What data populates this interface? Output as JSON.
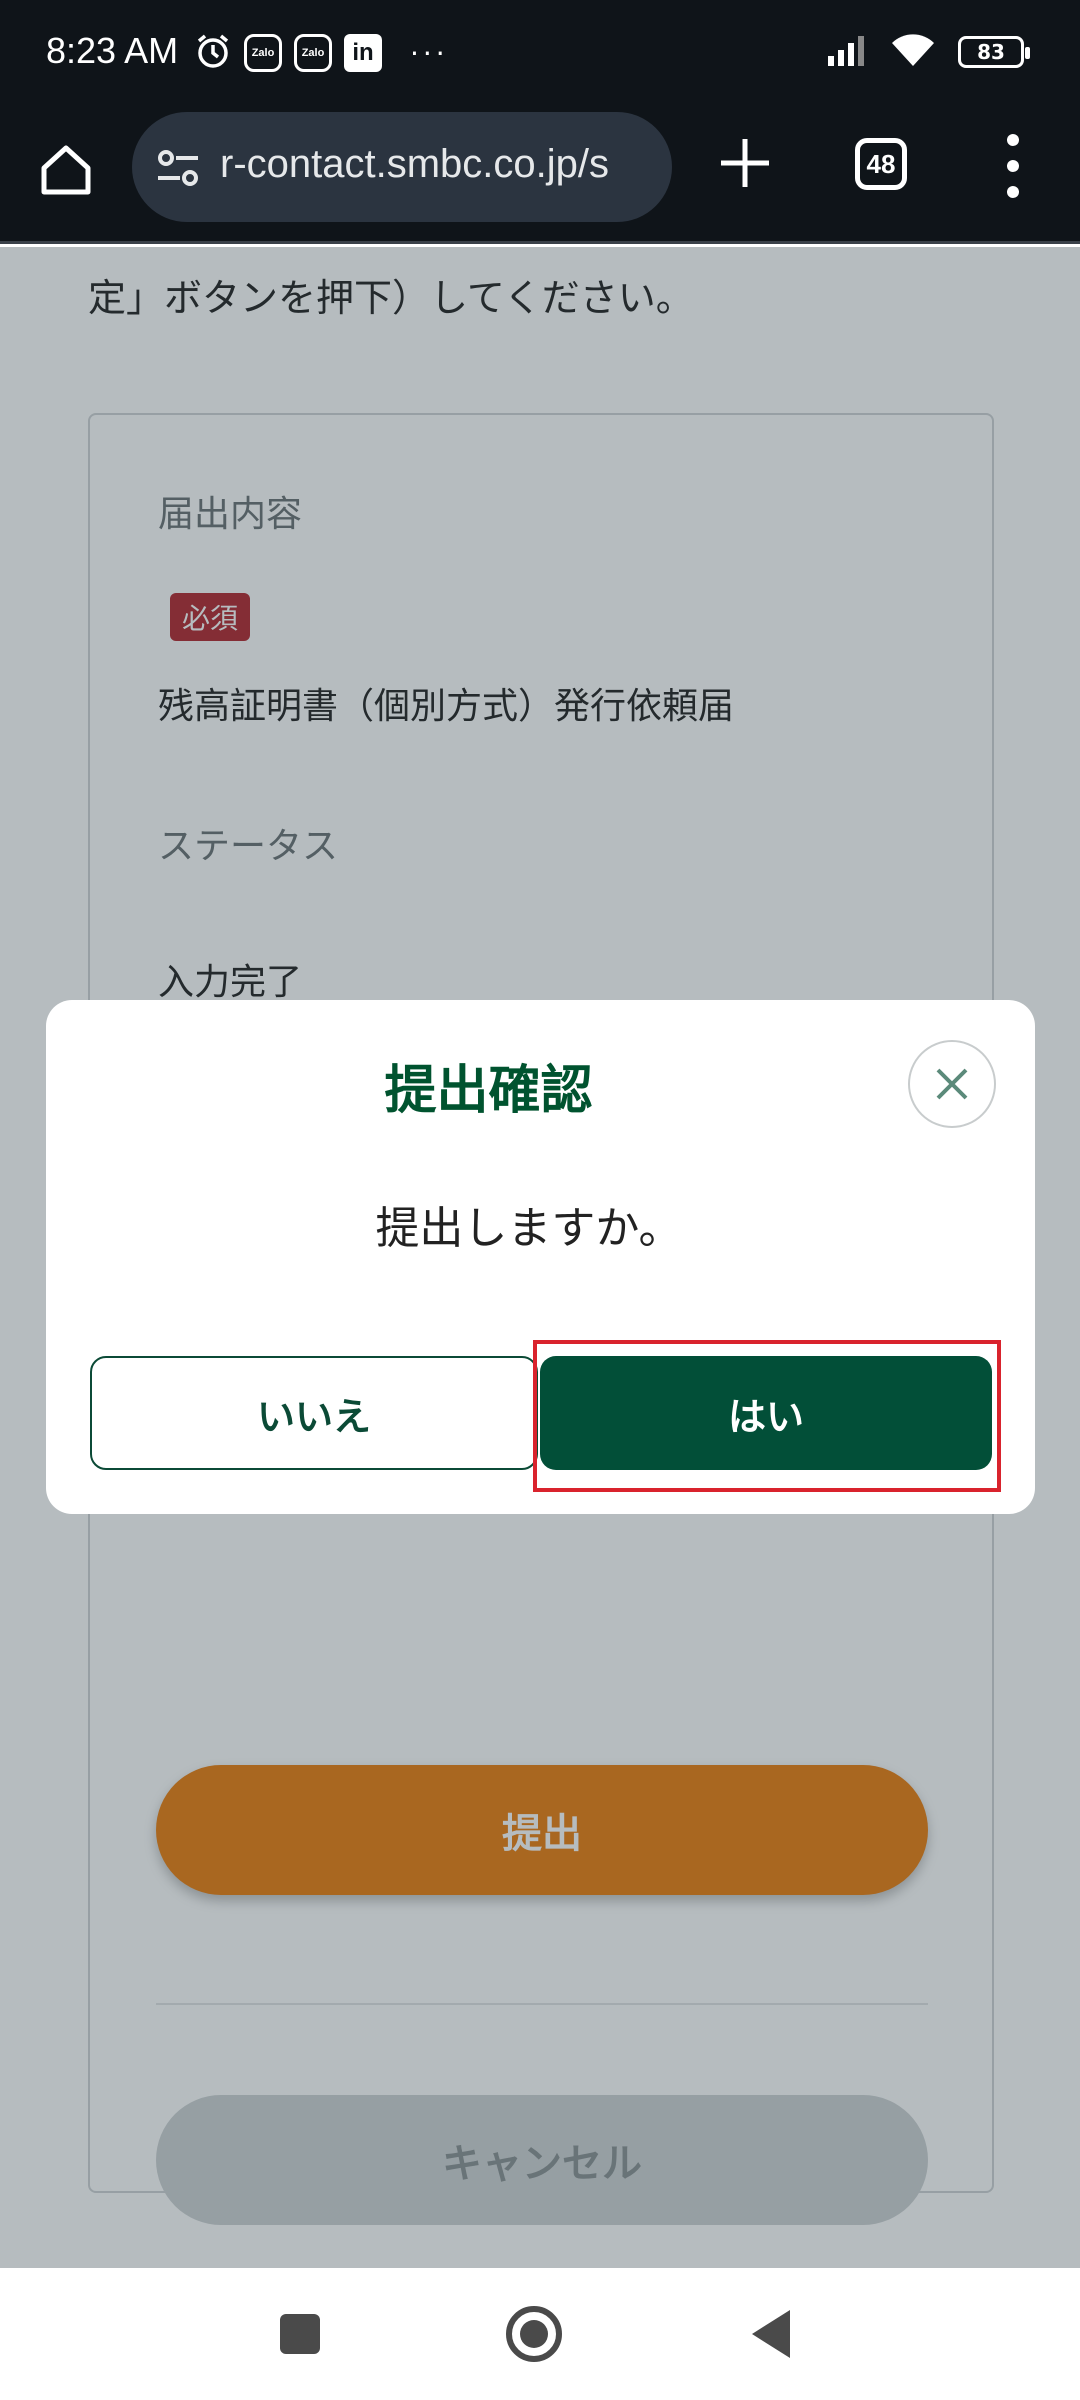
{
  "status_bar": {
    "time": "8:23 AM",
    "notification_icons": [
      "alarm-icon",
      "zalo-icon",
      "zalo-icon",
      "linkedin-icon"
    ],
    "zalo_label": "Zalo",
    "linkedin_label": "in",
    "more": "···",
    "battery": "83"
  },
  "browser": {
    "url": "r-contact.smbc.co.jp/s",
    "tab_count": "48"
  },
  "page": {
    "intro_text": "定」ボタンを押下）してください。",
    "fields": {
      "notification_label": "届出内容",
      "required_badge": "必須",
      "notification_value": "残高証明書（個別方式）発行依頼届",
      "status_label": "ステータス",
      "status_value": "入力完了"
    },
    "submit_button": "提出",
    "cancel_button": "キャンセル",
    "colors": {
      "submit": "#ec7e0f",
      "required": "#b3262e",
      "brand_green": "#024f38"
    }
  },
  "modal": {
    "title": "提出確認",
    "message": "提出しますか。",
    "no_button": "いいえ",
    "yes_button": "はい",
    "highlight_color": "#d9232d"
  }
}
